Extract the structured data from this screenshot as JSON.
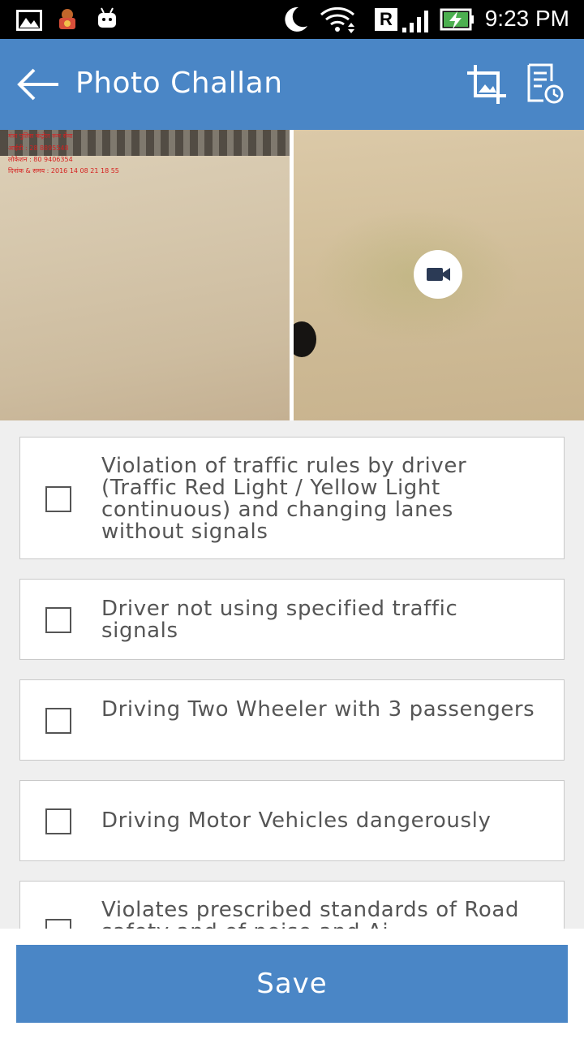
{
  "status_bar": {
    "time": "9:23 PM",
    "icons": [
      "gallery-icon",
      "police-emblem-icon",
      "android-icon",
      "moon-icon",
      "wifi-icon",
      "roaming-icon",
      "signal-icon",
      "battery-charging-icon"
    ],
    "roaming_letter": "R"
  },
  "app_bar": {
    "title": "Photo Challan",
    "icons": [
      "back-arrow-icon",
      "crop-icon",
      "history-icon"
    ]
  },
  "photos": {
    "left_overlay_lines": [
      "मंत्रा पुलिस कंट्रोल रूम सेवा",
      "आईडी : 28 8895548",
      "लोकेशन : 80 9406354",
      "दिनांक & समय : 2016 14 08 21 18 55"
    ],
    "video_icon": "videocam-icon"
  },
  "violations": [
    {
      "label": "Violation of traffic rules by driver (Traffic Red Light / Yellow Light continuous) and changing lanes without signals",
      "checked": false
    },
    {
      "label": "Driver not using specified traffic signals",
      "checked": false
    },
    {
      "label": "Driving Two Wheeler with 3 passengers",
      "checked": false
    },
    {
      "label": "Driving Motor Vehicles dangerously",
      "checked": false
    },
    {
      "label": "Violates prescribed standards of Road safety and of noise and Ai",
      "checked": false
    }
  ],
  "save_label": "Save",
  "colors": {
    "primary": "#4a86c6",
    "background": "#efefef",
    "text": "#555555"
  }
}
